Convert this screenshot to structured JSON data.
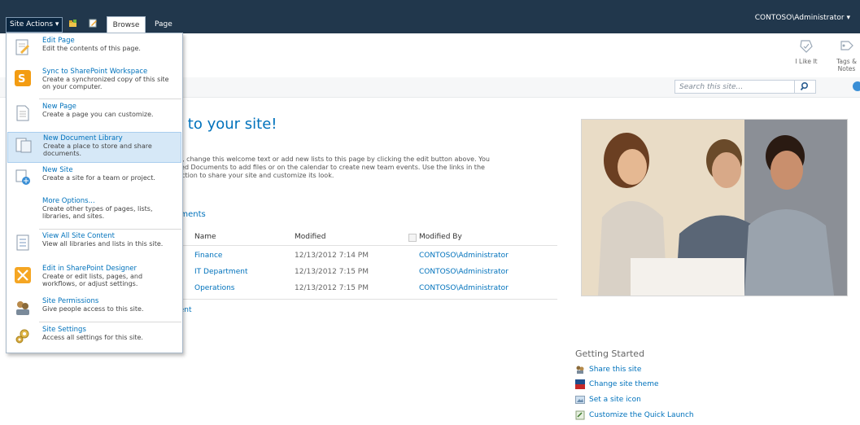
{
  "topbar": {
    "site_actions_label": "Site Actions ▾",
    "tabs": [
      {
        "label": "Browse"
      },
      {
        "label": "Page"
      }
    ],
    "user_label": "CONTOSO\\Administrator ▾"
  },
  "ribbon": {
    "i_like_it": "I Like It",
    "tags_notes_1": "Tags &",
    "tags_notes_2": "Notes"
  },
  "search": {
    "placeholder": "Search this site..."
  },
  "main": {
    "welcome_title": "e to your site!",
    "intro_lines": [
      "ge, change this welcome text or add new lists to this page by clicking the edit button above. You",
      "ared Documents to add files or on the calendar to create new team events. Use the links in the",
      "section to share your site and customize its look."
    ],
    "documents_title": "uments",
    "columns": [
      "Name",
      "Modified",
      "Modified By"
    ],
    "rows": [
      {
        "name": "Finance",
        "modified": "12/13/2012 7:14 PM",
        "by": "CONTOSO\\Administrator"
      },
      {
        "name": "IT Department",
        "modified": "12/13/2012 7:15 PM",
        "by": "CONTOSO\\Administrator"
      },
      {
        "name": "Operations",
        "modified": "12/13/2012 7:15 PM",
        "by": "CONTOSO\\Administrator"
      }
    ],
    "add_document": "nent"
  },
  "getting_started": {
    "title": "Getting Started",
    "items": [
      {
        "label": "Share this site"
      },
      {
        "label": "Change site theme"
      },
      {
        "label": "Set a site icon"
      },
      {
        "label": "Customize the Quick Launch"
      }
    ]
  },
  "menu": {
    "items": [
      {
        "title": "Edit Page",
        "desc": "Edit the contents of this page."
      },
      {
        "title": "Sync to SharePoint Workspace",
        "desc": "Create a synchronized copy of this site on your computer."
      },
      {
        "title": "New Page",
        "desc": "Create a page you can customize."
      },
      {
        "title": "New Document Library",
        "desc": "Create a place to store and share documents."
      },
      {
        "title": "New Site",
        "desc": "Create a site for a team or project."
      },
      {
        "title": "More Options...",
        "desc": "Create other types of pages, lists, libraries, and sites."
      },
      {
        "title": "View All Site Content",
        "desc": "View all libraries and lists in this site."
      },
      {
        "title": "Edit in SharePoint Designer",
        "desc": "Create or edit lists, pages, and workflows, or adjust settings."
      },
      {
        "title": "Site Permissions",
        "desc": "Give people access to this site."
      },
      {
        "title": "Site Settings",
        "desc": "Access all settings for this site."
      }
    ]
  },
  "colors": {
    "topbar": "#21374c",
    "link": "#0072bc",
    "menu_highlight": "#d6e8f7"
  }
}
